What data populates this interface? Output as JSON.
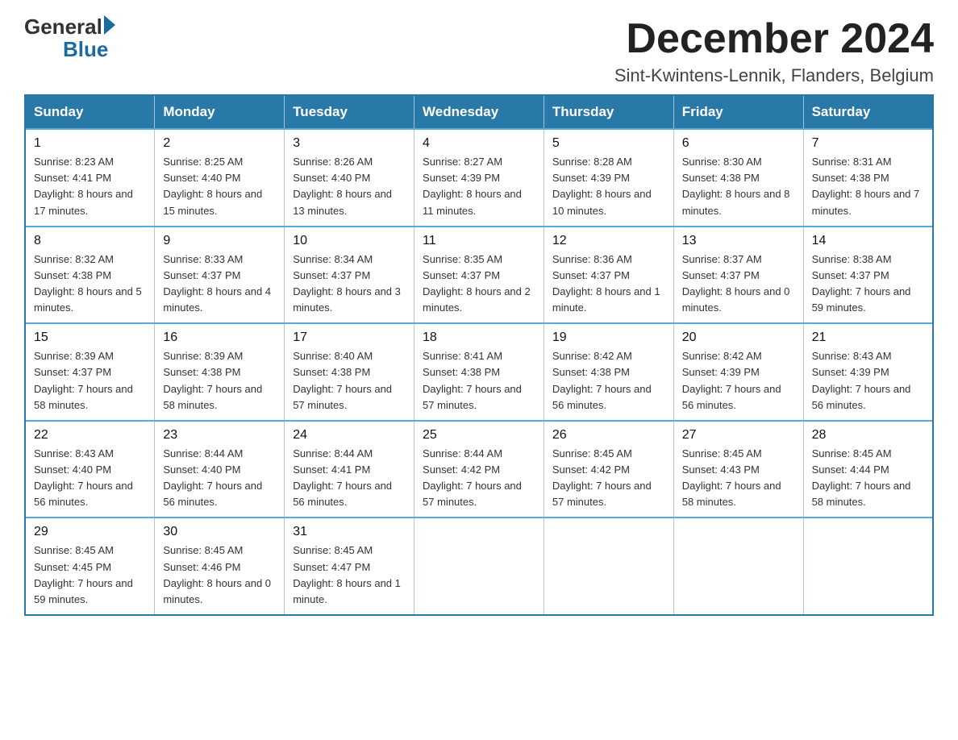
{
  "logo": {
    "general": "General",
    "blue": "Blue"
  },
  "header": {
    "title": "December 2024",
    "subtitle": "Sint-Kwintens-Lennik, Flanders, Belgium"
  },
  "calendar": {
    "days": [
      "Sunday",
      "Monday",
      "Tuesday",
      "Wednesday",
      "Thursday",
      "Friday",
      "Saturday"
    ],
    "weeks": [
      [
        {
          "num": "1",
          "sunrise": "8:23 AM",
          "sunset": "4:41 PM",
          "daylight": "8 hours and 17 minutes."
        },
        {
          "num": "2",
          "sunrise": "8:25 AM",
          "sunset": "4:40 PM",
          "daylight": "8 hours and 15 minutes."
        },
        {
          "num": "3",
          "sunrise": "8:26 AM",
          "sunset": "4:40 PM",
          "daylight": "8 hours and 13 minutes."
        },
        {
          "num": "4",
          "sunrise": "8:27 AM",
          "sunset": "4:39 PM",
          "daylight": "8 hours and 11 minutes."
        },
        {
          "num": "5",
          "sunrise": "8:28 AM",
          "sunset": "4:39 PM",
          "daylight": "8 hours and 10 minutes."
        },
        {
          "num": "6",
          "sunrise": "8:30 AM",
          "sunset": "4:38 PM",
          "daylight": "8 hours and 8 minutes."
        },
        {
          "num": "7",
          "sunrise": "8:31 AM",
          "sunset": "4:38 PM",
          "daylight": "8 hours and 7 minutes."
        }
      ],
      [
        {
          "num": "8",
          "sunrise": "8:32 AM",
          "sunset": "4:38 PM",
          "daylight": "8 hours and 5 minutes."
        },
        {
          "num": "9",
          "sunrise": "8:33 AM",
          "sunset": "4:37 PM",
          "daylight": "8 hours and 4 minutes."
        },
        {
          "num": "10",
          "sunrise": "8:34 AM",
          "sunset": "4:37 PM",
          "daylight": "8 hours and 3 minutes."
        },
        {
          "num": "11",
          "sunrise": "8:35 AM",
          "sunset": "4:37 PM",
          "daylight": "8 hours and 2 minutes."
        },
        {
          "num": "12",
          "sunrise": "8:36 AM",
          "sunset": "4:37 PM",
          "daylight": "8 hours and 1 minute."
        },
        {
          "num": "13",
          "sunrise": "8:37 AM",
          "sunset": "4:37 PM",
          "daylight": "8 hours and 0 minutes."
        },
        {
          "num": "14",
          "sunrise": "8:38 AM",
          "sunset": "4:37 PM",
          "daylight": "7 hours and 59 minutes."
        }
      ],
      [
        {
          "num": "15",
          "sunrise": "8:39 AM",
          "sunset": "4:37 PM",
          "daylight": "7 hours and 58 minutes."
        },
        {
          "num": "16",
          "sunrise": "8:39 AM",
          "sunset": "4:38 PM",
          "daylight": "7 hours and 58 minutes."
        },
        {
          "num": "17",
          "sunrise": "8:40 AM",
          "sunset": "4:38 PM",
          "daylight": "7 hours and 57 minutes."
        },
        {
          "num": "18",
          "sunrise": "8:41 AM",
          "sunset": "4:38 PM",
          "daylight": "7 hours and 57 minutes."
        },
        {
          "num": "19",
          "sunrise": "8:42 AM",
          "sunset": "4:38 PM",
          "daylight": "7 hours and 56 minutes."
        },
        {
          "num": "20",
          "sunrise": "8:42 AM",
          "sunset": "4:39 PM",
          "daylight": "7 hours and 56 minutes."
        },
        {
          "num": "21",
          "sunrise": "8:43 AM",
          "sunset": "4:39 PM",
          "daylight": "7 hours and 56 minutes."
        }
      ],
      [
        {
          "num": "22",
          "sunrise": "8:43 AM",
          "sunset": "4:40 PM",
          "daylight": "7 hours and 56 minutes."
        },
        {
          "num": "23",
          "sunrise": "8:44 AM",
          "sunset": "4:40 PM",
          "daylight": "7 hours and 56 minutes."
        },
        {
          "num": "24",
          "sunrise": "8:44 AM",
          "sunset": "4:41 PM",
          "daylight": "7 hours and 56 minutes."
        },
        {
          "num": "25",
          "sunrise": "8:44 AM",
          "sunset": "4:42 PM",
          "daylight": "7 hours and 57 minutes."
        },
        {
          "num": "26",
          "sunrise": "8:45 AM",
          "sunset": "4:42 PM",
          "daylight": "7 hours and 57 minutes."
        },
        {
          "num": "27",
          "sunrise": "8:45 AM",
          "sunset": "4:43 PM",
          "daylight": "7 hours and 58 minutes."
        },
        {
          "num": "28",
          "sunrise": "8:45 AM",
          "sunset": "4:44 PM",
          "daylight": "7 hours and 58 minutes."
        }
      ],
      [
        {
          "num": "29",
          "sunrise": "8:45 AM",
          "sunset": "4:45 PM",
          "daylight": "7 hours and 59 minutes."
        },
        {
          "num": "30",
          "sunrise": "8:45 AM",
          "sunset": "4:46 PM",
          "daylight": "8 hours and 0 minutes."
        },
        {
          "num": "31",
          "sunrise": "8:45 AM",
          "sunset": "4:47 PM",
          "daylight": "8 hours and 1 minute."
        },
        null,
        null,
        null,
        null
      ]
    ]
  }
}
